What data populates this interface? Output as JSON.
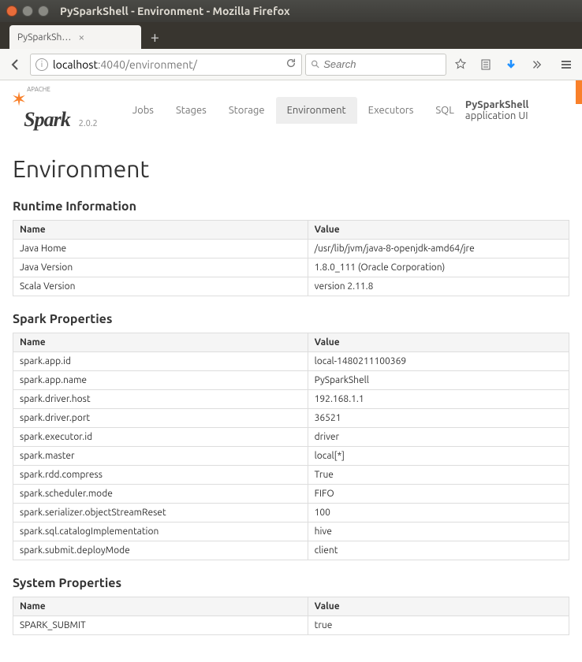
{
  "window": {
    "title": "PySparkShell - Environment - Mozilla Firefox",
    "tab_title": "PySparkShell - Environ…",
    "url_prefix": "localhost",
    "url_rest": ":4040/environment/",
    "search_placeholder": "Search"
  },
  "spark": {
    "edition": "APACHE",
    "name": "Spark",
    "version": "2.0.2",
    "nav": {
      "jobs": "Jobs",
      "stages": "Stages",
      "storage": "Storage",
      "environment": "Environment",
      "executors": "Executors",
      "sql": "SQL"
    },
    "app_name_bold": "PySparkShell",
    "app_name_rest": " application UI"
  },
  "page": {
    "heading": "Environment",
    "sections": {
      "runtime": {
        "title": "Runtime Information",
        "name_h": "Name",
        "value_h": "Value",
        "rows": [
          {
            "name": "Java Home",
            "value": "/usr/lib/jvm/java-8-openjdk-amd64/jre"
          },
          {
            "name": "Java Version",
            "value": "1.8.0_111 (Oracle Corporation)"
          },
          {
            "name": "Scala Version",
            "value": "version 2.11.8"
          }
        ]
      },
      "sparkprops": {
        "title": "Spark Properties",
        "name_h": "Name",
        "value_h": "Value",
        "rows": [
          {
            "name": "spark.app.id",
            "value": "local-1480211100369"
          },
          {
            "name": "spark.app.name",
            "value": "PySparkShell"
          },
          {
            "name": "spark.driver.host",
            "value": "192.168.1.1"
          },
          {
            "name": "spark.driver.port",
            "value": "36521"
          },
          {
            "name": "spark.executor.id",
            "value": "driver"
          },
          {
            "name": "spark.master",
            "value": "local[*]"
          },
          {
            "name": "spark.rdd.compress",
            "value": "True"
          },
          {
            "name": "spark.scheduler.mode",
            "value": "FIFO"
          },
          {
            "name": "spark.serializer.objectStreamReset",
            "value": "100"
          },
          {
            "name": "spark.sql.catalogImplementation",
            "value": "hive"
          },
          {
            "name": "spark.submit.deployMode",
            "value": "client"
          }
        ]
      },
      "sysprops": {
        "title": "System Properties",
        "name_h": "Name",
        "value_h": "Value",
        "rows": [
          {
            "name": "SPARK_SUBMIT",
            "value": "true"
          }
        ]
      }
    }
  }
}
